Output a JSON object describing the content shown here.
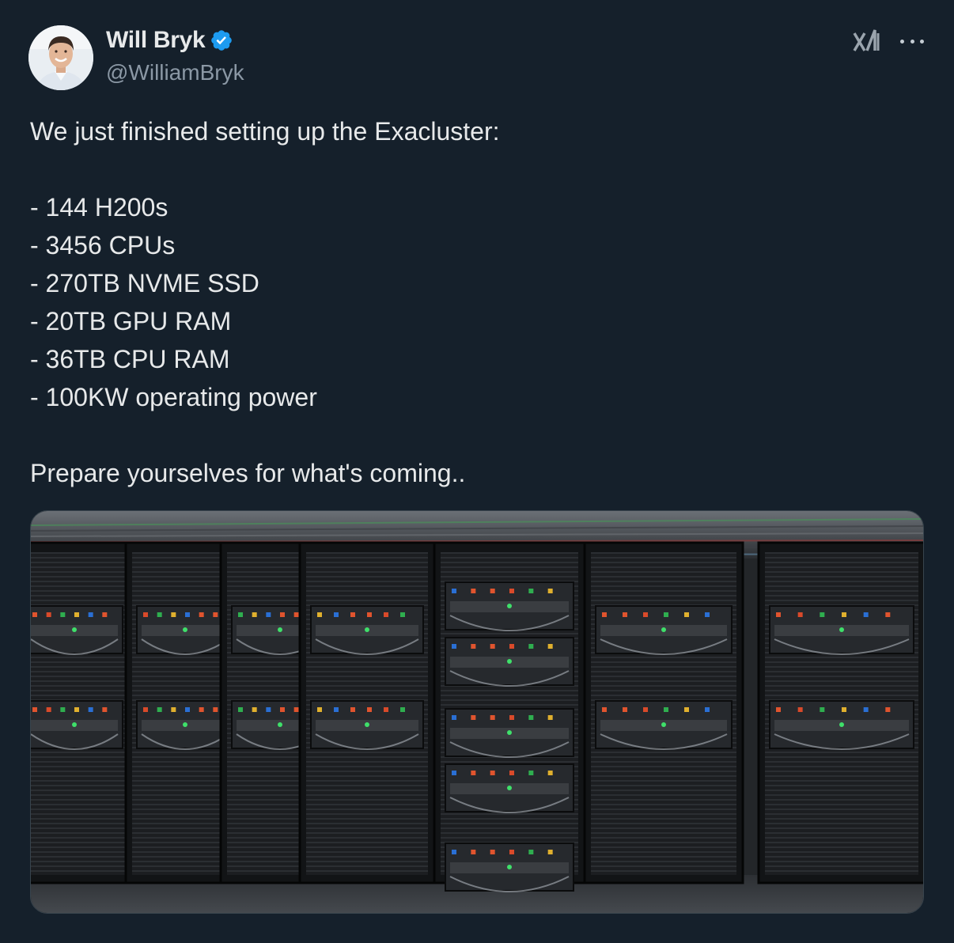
{
  "author": {
    "display_name": "Will Bryk",
    "handle": "@WilliamBryk",
    "verified": true,
    "avatar_icon": "profile-photo",
    "verified_icon": "verified-badge-icon"
  },
  "header_actions": {
    "logo_icon": "exa-logo-icon",
    "more_icon": "more-options-icon"
  },
  "tweet": {
    "intro": "We just finished setting up the Exacluster:",
    "specs": [
      "- 144 H200s",
      "- 3456 CPUs",
      "- 270TB NVME SSD",
      "- 20TB GPU RAM",
      "- 36TB CPU RAM",
      "- 100KW operating power"
    ],
    "outro": "Prepare yourselves for what's coming.."
  },
  "colors": {
    "background": "#15202b",
    "text": "#e7e9ea",
    "secondary_text": "#8b98a5",
    "verified_blue": "#1d9bf0",
    "media_border": "#38444d"
  }
}
